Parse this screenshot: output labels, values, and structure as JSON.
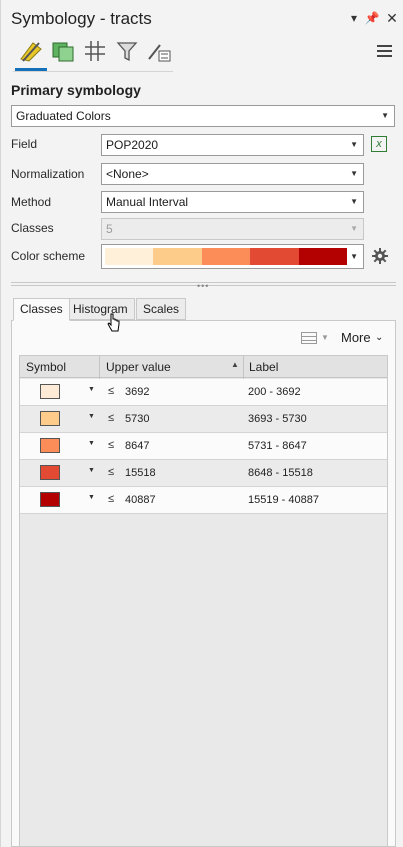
{
  "header": {
    "title": "Symbology - tracts"
  },
  "toolbar": {
    "tools": [
      "primary-symbology-icon",
      "vary-symbology-icon",
      "symbol-layers-icon",
      "filter-icon",
      "symbol-properties-icon"
    ]
  },
  "primary": {
    "section_title": "Primary symbology",
    "renderer": "Graduated Colors",
    "field_label": "Field",
    "field_value": "POP2020",
    "normalization_label": "Normalization",
    "normalization_value": "<None>",
    "method_label": "Method",
    "method_value": "Manual Interval",
    "classes_label": "Classes",
    "classes_value": "5",
    "color_scheme_label": "Color scheme",
    "color_scheme_colors": [
      "#fef0d9",
      "#fdcc8a",
      "#fc8d59",
      "#e34a33",
      "#b30000"
    ]
  },
  "tabs": {
    "classes": "Classes",
    "histogram": "Histogram",
    "scales": "Scales"
  },
  "classes_panel": {
    "more_label": "More"
  },
  "grid": {
    "headers": {
      "symbol": "Symbol",
      "upper": "Upper value",
      "label": "Label"
    },
    "rows": [
      {
        "color": "#fdebd7",
        "le": "≤",
        "upper": "3692",
        "label": "200 - 3692"
      },
      {
        "color": "#fdcc8a",
        "le": "≤",
        "upper": "5730",
        "label": "3693 - 5730"
      },
      {
        "color": "#fc8d59",
        "le": "≤",
        "upper": "8647",
        "label": "5731 - 8647"
      },
      {
        "color": "#e34a33",
        "le": "≤",
        "upper": "15518",
        "label": "8648 - 15518"
      },
      {
        "color": "#b30000",
        "le": "≤",
        "upper": "40887",
        "label": "15519 - 40887"
      }
    ]
  }
}
